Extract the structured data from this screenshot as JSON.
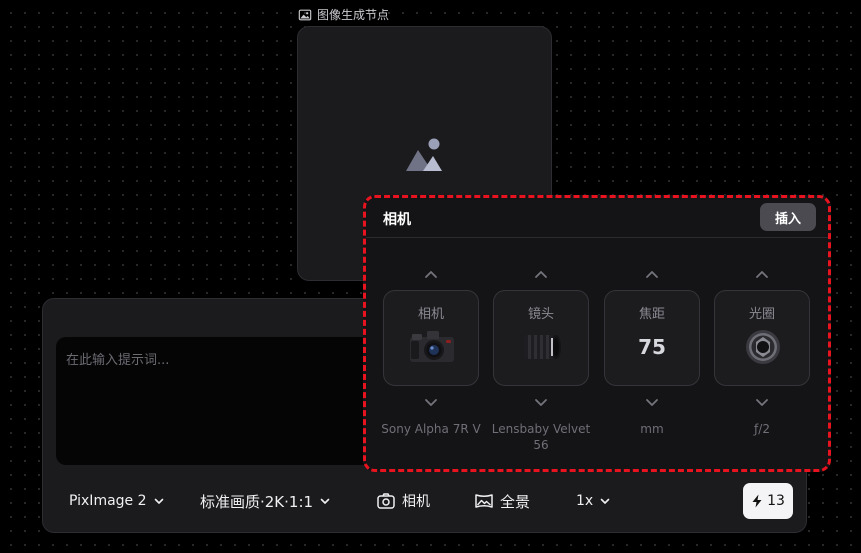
{
  "node": {
    "label": "图像生成节点",
    "label_icon": "image-icon",
    "placeholder_icon": "image-placeholder-icon"
  },
  "prompt": {
    "placeholder": "在此输入提示词...",
    "value": ""
  },
  "toolbar": {
    "model": "PixImage 2",
    "quality": "标准画质·2K·1:1",
    "camera": "相机",
    "panorama": "全景",
    "multiplier": "1x",
    "credits": "13"
  },
  "camera_panel": {
    "title": "相机",
    "insert_label": "插入",
    "columns": [
      {
        "label": "相机",
        "visual": "camera-body-icon",
        "caption": "Sony Alpha 7R V"
      },
      {
        "label": "镜头",
        "visual": "lens-icon",
        "caption": "Lensbaby Velvet 56"
      },
      {
        "label": "焦距",
        "value": "75",
        "caption": "mm"
      },
      {
        "label": "光圈",
        "visual": "aperture-icon",
        "caption": "ƒ/2"
      }
    ]
  },
  "colors": {
    "accent_dashed_border": "#e8131f",
    "panel_bg": "#1b1b1e",
    "credit_button_bg": "#f4f4f6"
  }
}
